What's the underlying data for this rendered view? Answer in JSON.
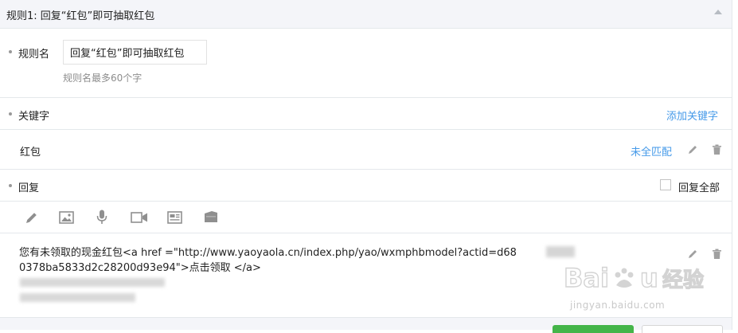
{
  "header": {
    "title": "规则1: 回复“红包”即可抽取红包"
  },
  "rule_name": {
    "label": "规则名",
    "value": "回复“红包”即可抽取红包",
    "hint": "规则名最多60个字"
  },
  "keywords": {
    "label": "关键字",
    "add_label": "添加关键字",
    "items": [
      {
        "text": "红包",
        "match": "未全匹配"
      }
    ]
  },
  "reply": {
    "label": "回复",
    "reply_all_label": "回复全部",
    "reply_all_checked": false,
    "toolbar": [
      "pencil-icon",
      "image-icon",
      "microphone-icon",
      "video-icon",
      "news-icon",
      "card-icon"
    ],
    "message": "您有未领取的现金红包<a href =\"http://www.yaoyaola.cn/index.php/yao/wxmphbmodel?actid=d68",
    "message_line2": "0378ba5833d2c28200d93e94\">点击领取 </a>"
  },
  "watermark": {
    "brand": "Baidu经验",
    "url": "jingyan.baidu.com"
  },
  "colors": {
    "accent": "#459ae9",
    "header_bg": "#f4f5f9",
    "border": "#e4e8eb",
    "primary_button": "#44b549"
  }
}
